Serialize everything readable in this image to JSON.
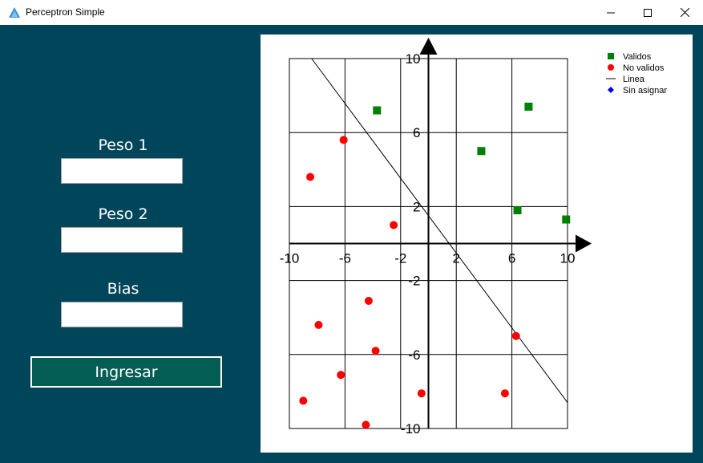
{
  "window": {
    "title": "Perceptron Simple",
    "minimize_glyph": "—",
    "maximize_glyph": "☐",
    "close_glyph": "✕"
  },
  "form": {
    "peso1_label": "Peso 1",
    "peso1_value": "",
    "peso2_label": "Peso 2",
    "peso2_value": "",
    "bias_label": "Bias",
    "bias_value": "",
    "submit_label": "Ingresar"
  },
  "colors": {
    "background": "#01455a",
    "button": "#045d54",
    "valid": "#008000",
    "invalid": "#ff0000",
    "unassigned": "#0000ff",
    "line": "#000000"
  },
  "chart_data": {
    "type": "scatter",
    "xlim": [
      -10,
      10
    ],
    "ylim": [
      -10,
      10
    ],
    "xticks": [
      -10,
      -6,
      -2,
      2,
      6,
      10
    ],
    "yticks": [
      -10,
      -6,
      -2,
      2,
      6,
      10
    ],
    "xtick_labels": [
      "-10",
      "-6",
      "-2",
      "2",
      "6",
      "10"
    ],
    "ytick_labels": [
      "-10",
      "-6",
      "-2",
      "2",
      "6",
      "10"
    ],
    "grid": true,
    "legend_position": "top-right",
    "legend": [
      "Validos",
      "No validos",
      "Linea",
      "Sin asignar"
    ],
    "series": [
      {
        "name": "Validos",
        "marker": "square",
        "color": "#008000",
        "points": [
          [
            -3.7,
            7.2
          ],
          [
            3.8,
            5.0
          ],
          [
            7.2,
            7.4
          ],
          [
            6.4,
            1.8
          ],
          [
            9.9,
            1.3
          ]
        ]
      },
      {
        "name": "No validos",
        "marker": "circle",
        "color": "#ff0000",
        "points": [
          [
            -6.1,
            5.6
          ],
          [
            -8.5,
            3.6
          ],
          [
            -2.5,
            1.0
          ],
          [
            -4.3,
            -3.1
          ],
          [
            -7.9,
            -4.4
          ],
          [
            -3.8,
            -5.8
          ],
          [
            -6.3,
            -7.1
          ],
          [
            -9.0,
            -8.5
          ],
          [
            -0.5,
            -8.1
          ],
          [
            -4.5,
            -9.8
          ],
          [
            5.5,
            -8.1
          ],
          [
            6.3,
            -5.0
          ]
        ]
      },
      {
        "name": "Linea",
        "type": "line",
        "color": "#000000",
        "points": [
          [
            -8.4,
            10
          ],
          [
            10,
            -8.6
          ]
        ]
      },
      {
        "name": "Sin asignar",
        "marker": "diamond",
        "color": "#0000ff",
        "points": []
      }
    ]
  }
}
